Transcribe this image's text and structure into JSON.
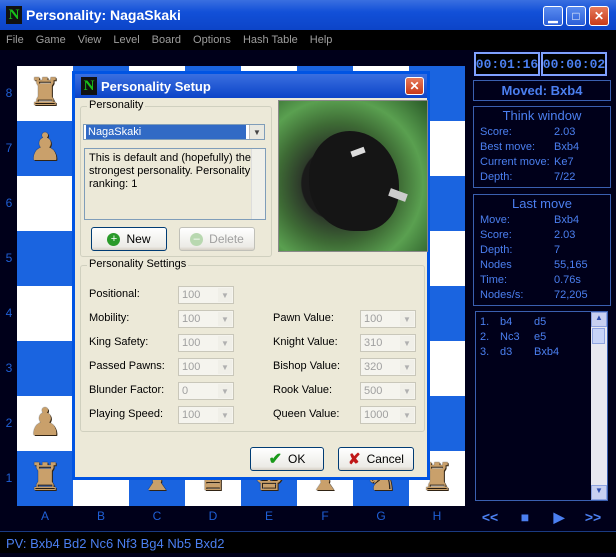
{
  "window": {
    "title": "Personality: NagaSkaki",
    "icon": "N"
  },
  "menu": [
    "File",
    "Game",
    "View",
    "Level",
    "Board",
    "Options",
    "Hash Table",
    "Help"
  ],
  "board": {
    "ranks": [
      "8",
      "7",
      "6",
      "5",
      "4",
      "3",
      "2",
      "1"
    ],
    "files": [
      "A",
      "B",
      "C",
      "D",
      "E",
      "F",
      "G",
      "H"
    ]
  },
  "clocks": {
    "white": "00:01:16",
    "black": "00:00:02"
  },
  "moved": "Moved: Bxb4",
  "think": {
    "title": "Think window",
    "rows": [
      [
        "Score:",
        "2.03"
      ],
      [
        "Best move:",
        "Bxb4"
      ],
      [
        "Current move:",
        "Ke7"
      ],
      [
        "Depth:",
        "7/22"
      ]
    ]
  },
  "last": {
    "title": "Last move",
    "rows": [
      [
        "Move:",
        "Bxb4"
      ],
      [
        "Score:",
        "2.03"
      ],
      [
        "Depth:",
        "7"
      ],
      [
        "Nodes",
        "55,165"
      ],
      [
        "Time:",
        "0.76s"
      ],
      [
        "Nodes/s:",
        "72,205"
      ]
    ]
  },
  "pvlist": [
    [
      "1.",
      "b4",
      "d5"
    ],
    [
      "2.",
      "Nc3",
      "e5"
    ],
    [
      "3.",
      "d3",
      "Bxb4"
    ]
  ],
  "nav": [
    "<<",
    "■",
    "▶",
    ">>"
  ],
  "pv": "PV: Bxb4 Bd2 Nc6 Nf3 Bg4 Nb5 Bxd2",
  "dialog": {
    "title": "Personality Setup",
    "icon": "N",
    "personality_label": "Personality",
    "selected": "NagaSkaki",
    "description": "This is default and (hopefully) the strongest personality. Personality ranking: 1",
    "new_label": "New",
    "delete_label": "Delete",
    "settings_label": "Personality Settings",
    "left": [
      [
        "Positional:",
        "100"
      ],
      [
        "Mobility:",
        "100"
      ],
      [
        "King Safety:",
        "100"
      ],
      [
        "Passed Pawns:",
        "100"
      ],
      [
        "Blunder Factor:",
        "0"
      ],
      [
        "Playing Speed:",
        "100"
      ]
    ],
    "right": [
      [
        "Pawn Value:",
        "100"
      ],
      [
        "Knight Value:",
        "310"
      ],
      [
        "Bishop Value:",
        "320"
      ],
      [
        "Rook Value:",
        "500"
      ],
      [
        "Queen Value:",
        "1000"
      ]
    ],
    "ok_label": "OK",
    "cancel_label": "Cancel"
  }
}
